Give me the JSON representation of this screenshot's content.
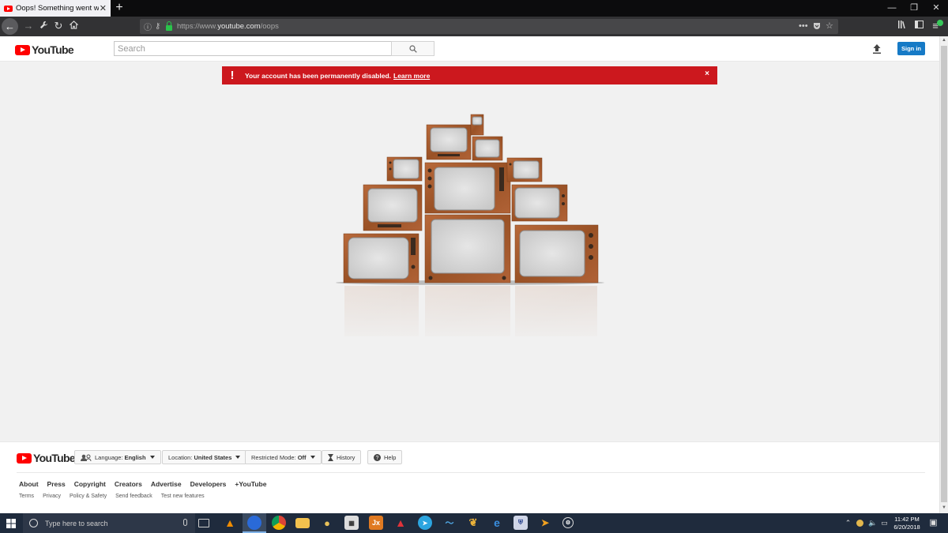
{
  "browser": {
    "tab_title": "Oops! Something went wrong",
    "tab_close": "✕",
    "new_tab": "+",
    "url_scheme": "https://www.",
    "url_domain": "youtube.com",
    "url_path": "/oops",
    "window_controls": [
      "—",
      "❐",
      "✕"
    ]
  },
  "header": {
    "logo_text": "YouTube",
    "search_placeholder": "Search",
    "signin_label": "Sign in"
  },
  "alert": {
    "icon": "!",
    "message": "Your account has been permanently disabled.",
    "link_text": "Learn more",
    "close": "×"
  },
  "colors": {
    "brand_red": "#ff0000",
    "alert_red": "#cc181e",
    "signin_blue": "#167ac6",
    "tv_wood": "#a0562a"
  },
  "footer": {
    "logo_text": "YouTube",
    "language_label": "Language:",
    "language_value": "English",
    "location_label": "Location:",
    "location_value": "United States",
    "restricted_label": "Restricted Mode:",
    "restricted_value": "Off",
    "history_label": "History",
    "help_label": "Help",
    "links_primary": [
      "About",
      "Press",
      "Copyright",
      "Creators",
      "Advertise",
      "Developers",
      "+YouTube"
    ],
    "links_secondary": [
      "Terms",
      "Privacy",
      "Policy & Safety",
      "Send feedback",
      "Test new features"
    ]
  },
  "taskbar": {
    "search_placeholder": "Type here to search",
    "time": "11:42 PM",
    "date": "6/20/2018"
  },
  "icons": [
    "back-arrow-icon",
    "forward-arrow-icon",
    "wrench-icon",
    "reload-icon",
    "home-icon",
    "search-icon",
    "upload-icon",
    "alert-icon",
    "close-icon",
    "history-icon",
    "help-icon",
    "windows-start-icon"
  ]
}
